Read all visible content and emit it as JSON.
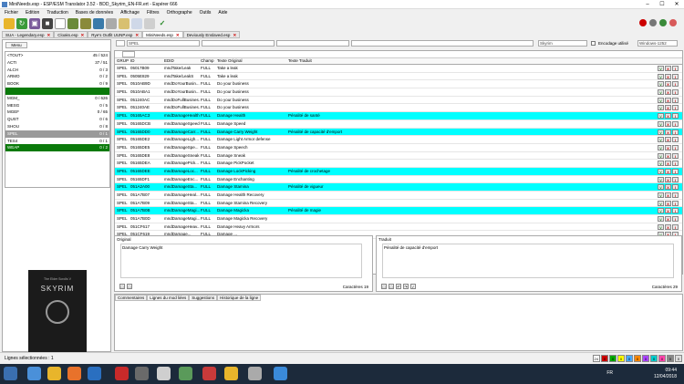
{
  "window": {
    "title": "MiniNeeds.esp - ESP/ESM Translator 3.52 - BDD_Skyrim_EN-FR.ert - Espérer 666"
  },
  "menu": [
    "Fichier",
    "Edition",
    "Traduction",
    "Bases de données",
    "Affichage",
    "Filtres",
    "Orthographe",
    "Outils",
    "Aide"
  ],
  "tabs": [
    {
      "label": "SUA - Legendary.esp"
    },
    {
      "label": "Cloaks.esp"
    },
    {
      "label": "Rye's Outfit UUNP.esp"
    },
    {
      "label": "MiniNeeds.esp"
    },
    {
      "label": "Deviously Enslaved.esp"
    }
  ],
  "left": {
    "menu_label": "Menu",
    "categories": [
      {
        "name": "<TOUT>",
        "count": "45 / 524",
        "style": "plain"
      },
      {
        "name": "ACTI",
        "count": "37 / 51",
        "style": "plain"
      },
      {
        "name": "ALCH",
        "count": "0 / 3",
        "style": "plain"
      },
      {
        "name": "ARMO",
        "count": "0 / 2",
        "style": "plain"
      },
      {
        "name": "BOOK",
        "count": "0 / 9",
        "style": "plain"
      },
      {
        "name": "",
        "count": "",
        "style": "green"
      },
      {
        "name": "MGM_",
        "count": "0 / 626",
        "style": "plain"
      },
      {
        "name": "MESG",
        "count": "0 / 5",
        "style": "plain"
      },
      {
        "name": "MGEF",
        "count": "0 / 65",
        "style": "plain"
      },
      {
        "name": "QUST",
        "count": "0 / 6",
        "style": "plain"
      },
      {
        "name": "SHOU",
        "count": "0 / 8",
        "style": "plain"
      },
      {
        "name": "SPEL",
        "count": "0 / 1",
        "style": "gray"
      },
      {
        "name": "TES4",
        "count": "0 / 1",
        "style": "plain"
      },
      {
        "name": "WEAP",
        "count": "0 / 2",
        "style": "green"
      }
    ]
  },
  "skyrim": {
    "small": "The Elder Scrolls V",
    "big": "SKYRIM"
  },
  "filters": {
    "type_value": "SPEL",
    "game_value": "Skyrim",
    "encoding_label": "Encodage utilisé",
    "encoding_value": "Windows-1252"
  },
  "grid": {
    "headers": [
      "GRUP",
      "ID",
      "EDID",
      "Champ",
      "Texte Original",
      "Texte Traduit"
    ],
    "rows": [
      {
        "grup": "SPEL",
        "id": "05017B09",
        "edid": "mndTake/Leak",
        "champ": "FULL",
        "orig": "Take a leak",
        "trad": "",
        "hl": false
      },
      {
        "grup": "SPEL",
        "id": "0505E829",
        "edid": "mndTake/LeakS",
        "champ": "FULL",
        "orig": "Take a leak",
        "trad": "",
        "hl": false
      },
      {
        "grup": "SPEL",
        "id": "0510AB9D",
        "edid": "mndDoYourBusin...",
        "champ": "FULL",
        "orig": "Do your business",
        "trad": "",
        "hl": false
      },
      {
        "grup": "SPEL",
        "id": "0510ABA1",
        "edid": "mndDoYourBusin...",
        "champ": "FULL",
        "orig": "Do your business",
        "trad": "",
        "hl": false
      },
      {
        "grup": "SPEL",
        "id": "051240AC",
        "edid": "mndDoFullBusines...",
        "champ": "FULL",
        "orig": "Do your business",
        "trad": "",
        "hl": false
      },
      {
        "grup": "SPEL",
        "id": "051240AE",
        "edid": "mndDoFullBusines...",
        "champ": "FULL",
        "orig": "Do your business",
        "trad": "",
        "hl": false
      },
      {
        "grup": "SPEL",
        "id": "05165AC3",
        "edid": "mndDamageHealth",
        "champ": "FULL",
        "orig": "Damage Health",
        "trad": "Pénalité de santé",
        "hl": true
      },
      {
        "grup": "SPEL",
        "id": "05165DCB",
        "edid": "mndDamageSpeed",
        "champ": "FULL",
        "orig": "Damage Speed",
        "trad": "",
        "hl": false
      },
      {
        "grup": "SPEL",
        "id": "05165DD0",
        "edid": "mndDamageCarr...",
        "champ": "FULL",
        "orig": "Damage Carry Weight",
        "trad": "Pénalité de capacité d'emport",
        "hl": true
      },
      {
        "grup": "SPEL",
        "id": "05165DE2",
        "edid": "mndDamageLigh...",
        "champ": "FULL",
        "orig": "Damage Light Armor defense",
        "trad": "",
        "hl": false
      },
      {
        "grup": "SPEL",
        "id": "05165DE5",
        "edid": "mndDamageSpe...",
        "champ": "FULL",
        "orig": "Damage Speech",
        "trad": "",
        "hl": false
      },
      {
        "grup": "SPEL",
        "id": "05165DE8",
        "edid": "mndDamageSneak",
        "champ": "FULL",
        "orig": "Damage Sneak",
        "trad": "",
        "hl": false
      },
      {
        "grup": "SPEL",
        "id": "05165DEA",
        "edid": "mndDamagePick...",
        "champ": "FULL",
        "orig": "Damage PickPocket",
        "trad": "",
        "hl": false
      },
      {
        "grup": "SPEL",
        "id": "05165DEE",
        "edid": "mndDamageLoc...",
        "champ": "FULL",
        "orig": "Damage LockPicking",
        "trad": "Pénalité de crochetage",
        "hl": true
      },
      {
        "grup": "SPEL",
        "id": "05165DF1",
        "edid": "mndDamageEnc...",
        "champ": "FULL",
        "orig": "Damage Enchanting",
        "trad": "",
        "hl": false
      },
      {
        "grup": "SPEL",
        "id": "051A2A00",
        "edid": "mndDamageSta...",
        "champ": "FULL",
        "orig": "Damage Stamina",
        "trad": "Pénalité de vigueur",
        "hl": true
      },
      {
        "grup": "SPEL",
        "id": "051A7B07",
        "edid": "mndDamageHeal...",
        "champ": "FULL",
        "orig": "Damage Health Recovery",
        "trad": "",
        "hl": false
      },
      {
        "grup": "SPEL",
        "id": "051A7B09",
        "edid": "mndDamageSta...",
        "champ": "FULL",
        "orig": "Damage Stamina Recovery",
        "trad": "",
        "hl": false
      },
      {
        "grup": "SPEL",
        "id": "051A7B0B",
        "edid": "mndDamageMagi...",
        "champ": "FULL",
        "orig": "Damage Magicka",
        "trad": "Pénalité de magie",
        "hl": true
      },
      {
        "grup": "SPEL",
        "id": "051A7B0D",
        "edid": "mndDamageMagi...",
        "champ": "FULL",
        "orig": "Damage Magicka Recovery",
        "trad": "",
        "hl": false
      },
      {
        "grup": "SPEL",
        "id": "051CF617",
        "edid": "mndDamageHeav...",
        "champ": "FULL",
        "orig": "Damage Heavy Armors",
        "trad": "",
        "hl": false
      },
      {
        "grup": "SPEL",
        "id": "051CF619",
        "edid": "mndDamage...",
        "champ": "FULL",
        "orig": "Damage ...",
        "trad": "",
        "hl": false
      }
    ]
  },
  "original": {
    "label": "Original",
    "text": "Damage Carry Weight",
    "chars_label": "Caractères",
    "chars": "19"
  },
  "traduit": {
    "label": "Traduit",
    "text": "Pénalité de capacité d'emport",
    "chars_label": "Caractères",
    "chars": "29"
  },
  "comment_tabs": [
    "Commentaires",
    "Lignes du mod liées",
    "Suggestions",
    "Historique de la ligne"
  ],
  "status": {
    "selected_label": "Lignes sélectionnées :",
    "selected": "1",
    "badges": [
      "24",
      "0",
      "0",
      "0",
      "0",
      "0",
      "0",
      "0",
      "0",
      "0",
      "0"
    ]
  },
  "taskbar": {
    "lang": "FR",
    "time": "09:44",
    "date": "12/04/2018"
  }
}
